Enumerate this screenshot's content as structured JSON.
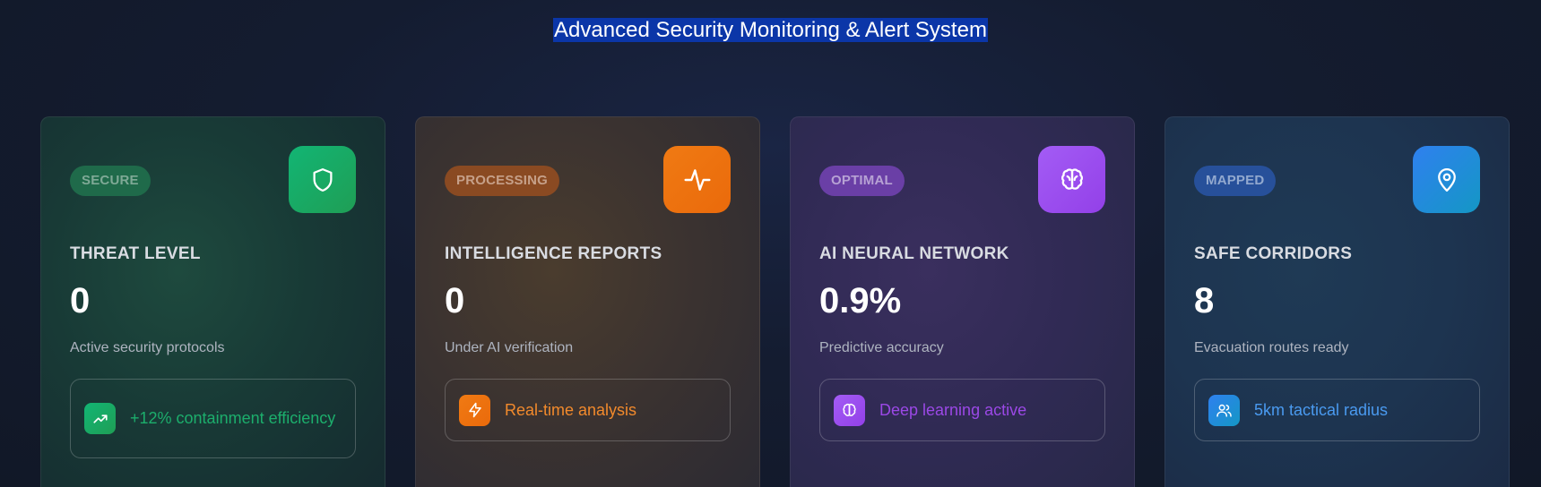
{
  "header": {
    "title": "Advanced Security Monitoring & Alert System"
  },
  "cards": [
    {
      "badge": "SECURE",
      "icon": "shield-icon",
      "title": "THREAT LEVEL",
      "value": "0",
      "description": "Active security protocols",
      "feature": {
        "icon": "trending-up-icon",
        "text": "+12% containment efficiency"
      },
      "accent": "#16a96a"
    },
    {
      "badge": "PROCESSING",
      "icon": "activity-pulse-icon",
      "title": "INTELLIGENCE REPORTS",
      "value": "0",
      "description": "Under AI verification",
      "feature": {
        "icon": "lightning-bolt-icon",
        "text": "Real-time analysis"
      },
      "accent": "#f07a13"
    },
    {
      "badge": "OPTIMAL",
      "icon": "brain-icon",
      "title": "AI NEURAL NETWORK",
      "value": "0.9%",
      "description": "Predictive accuracy",
      "feature": {
        "icon": "brain-icon",
        "text": "Deep learning active"
      },
      "accent": "#9b48e6"
    },
    {
      "badge": "MAPPED",
      "icon": "map-pin-icon",
      "title": "SAFE CORRIDORS",
      "value": "8",
      "description": "Evacuation routes ready",
      "feature": {
        "icon": "users-icon",
        "text": "5km tactical radius"
      },
      "accent": "#2f80ef"
    }
  ]
}
